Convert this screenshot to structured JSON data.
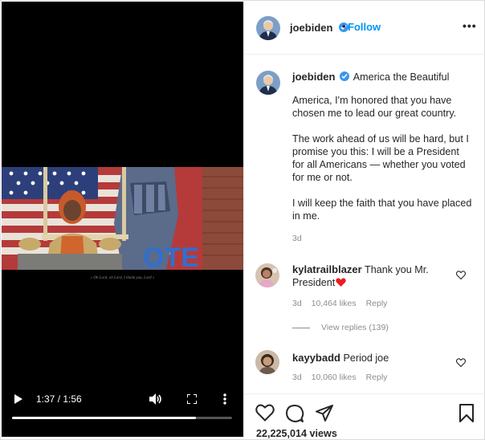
{
  "video": {
    "caption": "♪ Oh Lord, oh Lord, I thank you, Lord ♪",
    "mural_text": "OTE",
    "time": "1:37 / 1:56",
    "progress": 0.836
  },
  "header": {
    "username": "joebiden",
    "separator": "•",
    "follow_label": "Follow",
    "more_label": "•••"
  },
  "post": {
    "username": "joebiden",
    "title": "America the Beautiful",
    "paragraphs": [
      "America, I'm honored that you have chosen me to lead our great country.",
      "The work ahead of us will be hard, but I promise you this: I will be a President for all Americans — whether you voted for me or not.",
      "I will keep the faith that you have placed in me."
    ],
    "time_ago": "3d"
  },
  "comments": [
    {
      "username": "kylatrailblazer",
      "text": "Thank you Mr. President",
      "time_ago": "3d",
      "likes": "10,464 likes",
      "reply_label": "Reply"
    },
    {
      "username": "kayybadd",
      "text": "Period joe",
      "time_ago": "3d",
      "likes": "10,060 likes",
      "reply_label": "Reply"
    }
  ],
  "view_replies_label": "View replies (139)",
  "views": "22,225,014 views",
  "colors": {
    "accent": "#0095f6",
    "verified": "#3897f0",
    "muted": "#8e8e8e",
    "heart": "#ed1c24"
  }
}
